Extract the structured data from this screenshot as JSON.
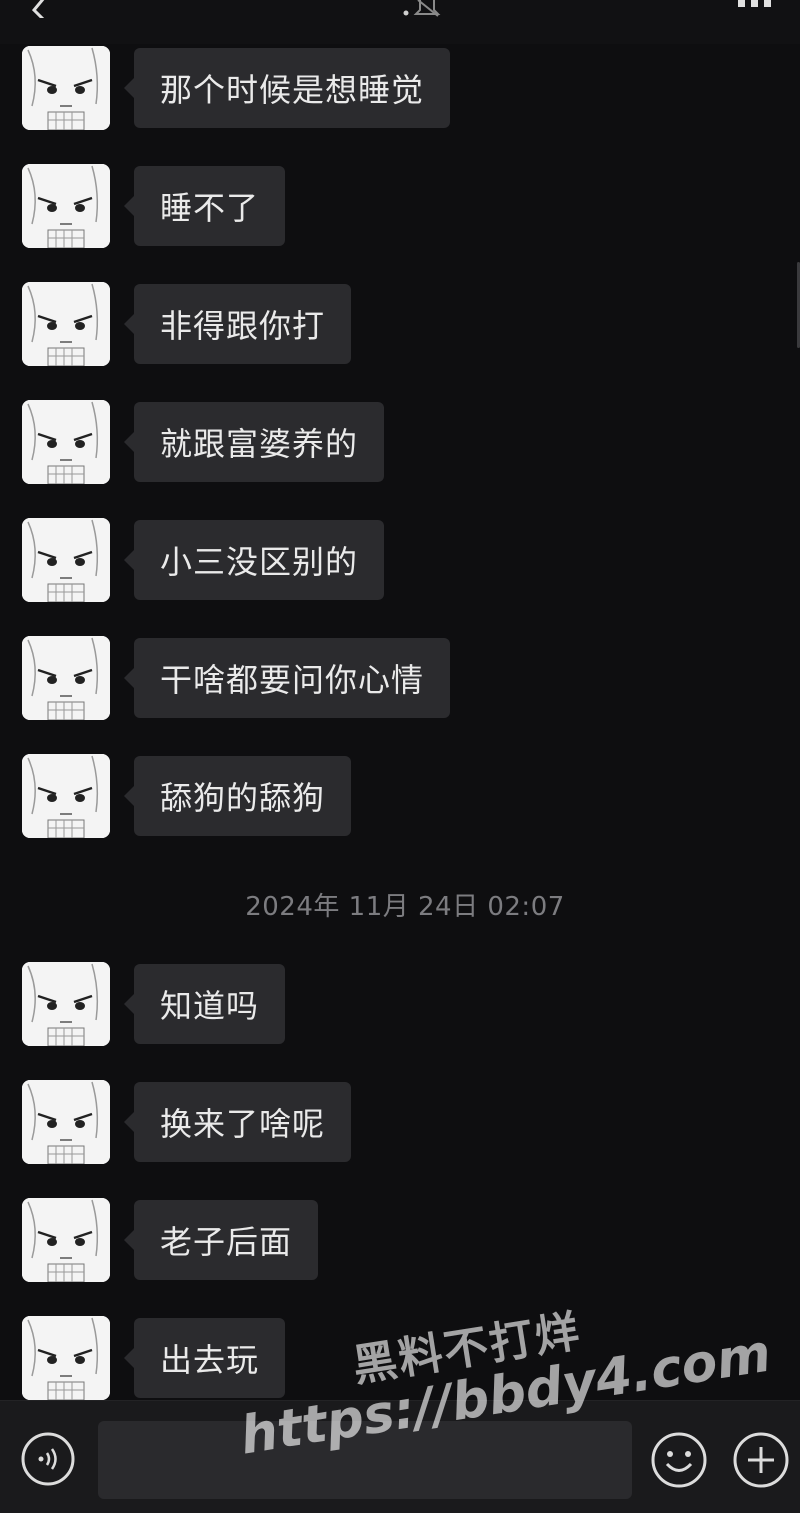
{
  "header": {
    "back_icon": "chevron-left-icon",
    "mute_icon": "muted-bell-icon",
    "more_icon": "more-dots-icon"
  },
  "messages": [
    {
      "text": "那个时候是想睡觉"
    },
    {
      "text": "睡不了"
    },
    {
      "text": "非得跟你打"
    },
    {
      "text": "就跟富婆养的"
    },
    {
      "text": "小三没区别的"
    },
    {
      "text": "干啥都要问你心情"
    },
    {
      "text": "舔狗的舔狗"
    },
    {
      "text": "知道吗"
    },
    {
      "text": "换来了啥呢"
    },
    {
      "text": "老子后面"
    },
    {
      "text": "出去玩"
    }
  ],
  "timestamp": "2024年 11月 24日 02:07",
  "input_bar": {
    "voice_icon": "voice-icon",
    "emoji_icon": "emoji-icon",
    "plus_icon": "plus-icon",
    "message_value": ""
  },
  "watermark": {
    "line1": "黑料不打烊",
    "line2": "https://bbdy4.com"
  },
  "colors": {
    "background": "#0e0e10",
    "bubble": "#2b2b2e",
    "text": "#eaeaea",
    "timestamp": "#7c7c80"
  }
}
